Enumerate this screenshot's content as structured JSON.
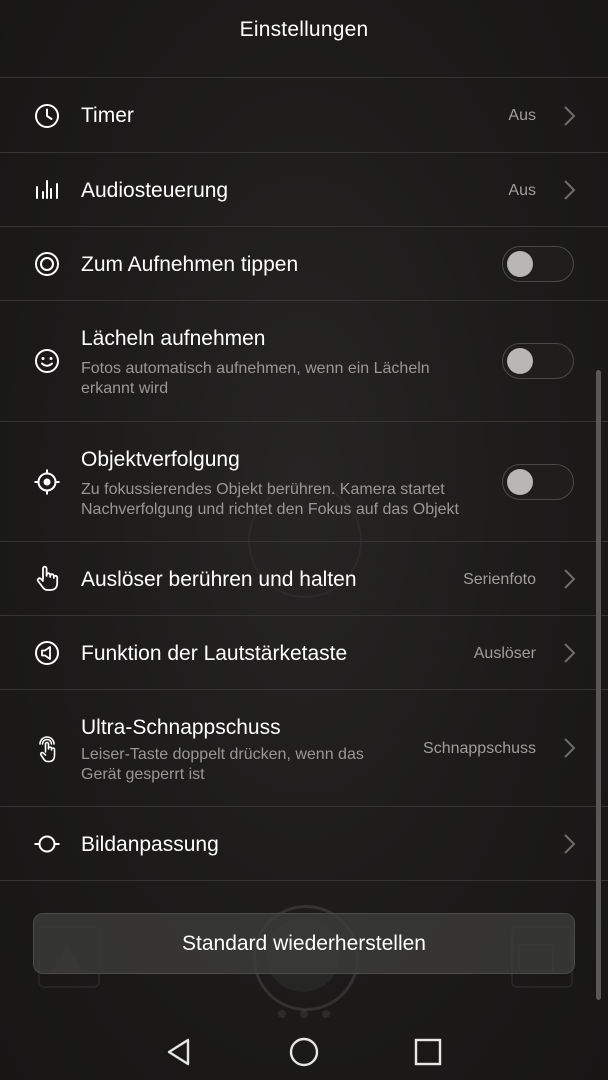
{
  "header": {
    "title": "Einstellungen"
  },
  "settings": {
    "timer": {
      "title": "Timer",
      "value": "Aus",
      "icon": "clock-icon"
    },
    "audio": {
      "title": "Audiosteuerung",
      "value": "Aus",
      "icon": "audio-bars-icon"
    },
    "tap": {
      "title": "Zum Aufnehmen tippen",
      "enabled": false,
      "icon": "target-circle-icon"
    },
    "smile": {
      "title": "Lächeln aufnehmen",
      "subtitle": "Fotos automatisch aufnehmen, wenn ein Lächeln erkannt wird",
      "enabled": false,
      "icon": "smiley-icon"
    },
    "tracking": {
      "title": "Objektverfolgung",
      "subtitle": "Zu fokussierendes Objekt berühren. Kamera startet Nachverfolgung und richtet den Fokus auf das Objekt",
      "enabled": false,
      "icon": "crosshair-icon"
    },
    "hold": {
      "title": "Auslöser berühren und halten",
      "value": "Serienfoto",
      "icon": "touch-hand-icon"
    },
    "volume": {
      "title": "Funktion der Lautstärketaste",
      "value": "Auslöser",
      "icon": "speaker-icon"
    },
    "ultra": {
      "title": "Ultra-Schnappschuss",
      "subtitle": "Leiser-Taste doppelt drücken, wenn das Gerät gesperrt ist",
      "value": "Schnappschuss",
      "icon": "double-tap-hand-icon"
    },
    "adjust": {
      "title": "Bildanpassung",
      "icon": "adjust-slider-icon"
    }
  },
  "reset_label": "Standard wiederherstellen",
  "navbar": {
    "back_icon": "back-triangle-icon",
    "home_icon": "home-circle-icon",
    "recents_icon": "recents-square-icon"
  },
  "colors": {
    "background": "#1b1b1b",
    "divider": "#363534",
    "text": "#ffffff",
    "secondary": "#9a9896"
  }
}
